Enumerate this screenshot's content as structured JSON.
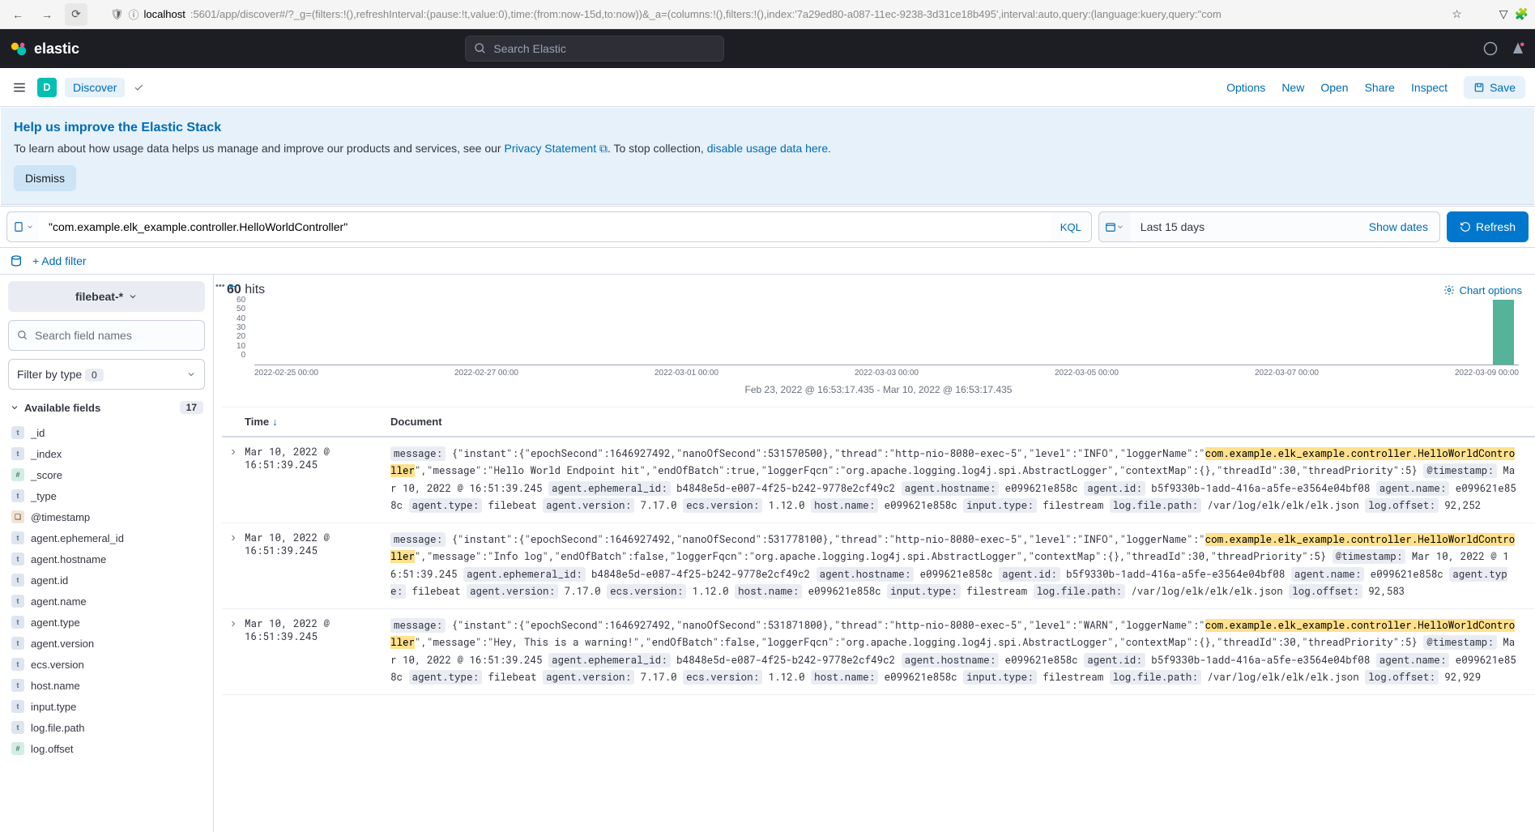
{
  "browser": {
    "url_host": "localhost",
    "url_rest": ":5601/app/discover#/?_g=(filters:!(),refreshInterval:(pause:!t,value:0),time:(from:now-15d,to:now))&_a=(columns:!(),filters:!(),index:'7a29ed80-a087-11ec-9238-3d31ce18b495',interval:auto,query:(language:kuery,query:\"com"
  },
  "elastic": {
    "brand": "elastic",
    "search_placeholder": "Search Elastic"
  },
  "nav": {
    "space_letter": "D",
    "app": "Discover",
    "links": [
      "Options",
      "New",
      "Open",
      "Share",
      "Inspect"
    ],
    "save": "Save"
  },
  "banner": {
    "title": "Help us improve the Elastic Stack",
    "text_pre": "To learn about how usage data helps us manage and improve our products and services, see our ",
    "privacy": "Privacy Statement",
    "text_mid": ". To stop collection, ",
    "disable": "disable usage data here.",
    "dismiss": "Dismiss"
  },
  "query": {
    "value": "\"com.example.elk_example.controller.HelloWorldController\"",
    "kql": "KQL",
    "range": "Last 15 days",
    "show_dates": "Show dates",
    "refresh": "Refresh"
  },
  "filters": {
    "add": "+ Add filter"
  },
  "sidebar": {
    "index": "filebeat-*",
    "search_fields_ph": "Search field names",
    "filter_type_label": "Filter by type",
    "filter_type_count": "0",
    "available_label": "Available fields",
    "available_count": "17",
    "fields": [
      {
        "type": "t",
        "name": "_id"
      },
      {
        "type": "t",
        "name": "_index"
      },
      {
        "type": "n",
        "name": "_score"
      },
      {
        "type": "t",
        "name": "_type"
      },
      {
        "type": "d",
        "name": "@timestamp"
      },
      {
        "type": "t",
        "name": "agent.ephemeral_id"
      },
      {
        "type": "t",
        "name": "agent.hostname"
      },
      {
        "type": "t",
        "name": "agent.id"
      },
      {
        "type": "t",
        "name": "agent.name"
      },
      {
        "type": "t",
        "name": "agent.type"
      },
      {
        "type": "t",
        "name": "agent.version"
      },
      {
        "type": "t",
        "name": "ecs.version"
      },
      {
        "type": "t",
        "name": "host.name"
      },
      {
        "type": "t",
        "name": "input.type"
      },
      {
        "type": "t",
        "name": "log.file.path"
      },
      {
        "type": "n",
        "name": "log.offset"
      }
    ]
  },
  "hits": {
    "count": "60",
    "label": " hits",
    "chart_options": "Chart options"
  },
  "chart_data": {
    "type": "bar",
    "ylim": [
      0,
      60
    ],
    "y_ticks": [
      "60",
      "50",
      "40",
      "30",
      "20",
      "10",
      "0"
    ],
    "x_ticks": [
      "2022-02-25 00:00",
      "2022-02-27 00:00",
      "2022-03-01 00:00",
      "2022-03-03 00:00",
      "2022-03-05 00:00",
      "2022-03-07 00:00",
      "2022-03-09 00:00"
    ],
    "series": [
      {
        "name": "count",
        "x": "2022-03-10",
        "value": 60
      }
    ],
    "caption": "Feb 23, 2022 @ 16:53:17.435 - Mar 10, 2022 @ 16:53:17.435"
  },
  "table": {
    "col_time": "Time",
    "col_doc": "Document",
    "rows": [
      {
        "time": "Mar 10, 2022 @ 16:51:39.245",
        "msg_pre": "{\"instant\":{\"epochSecond\":1646927492,\"nanoOfSecond\":531570500},\"thread\":\"http-nio-8080-exec-5\",\"level\":\"INFO\",\"loggerName\":\"",
        "msg_hl": "com.example.elk_example.controller.HelloWorldController",
        "msg_post": "\",\"message\":\"Hello World Endpoint hit\",\"endOfBatch\":true,\"loggerFqcn\":\"org.apache.logging.log4j.spi.AbstractLogger\",\"contextMap\":{},\"threadId\":30,\"threadPriority\":5}",
        "ts": "Mar 10, 2022 @ 16:51:39.245",
        "eph": "b4848e5d-e007-4f25-b242-9778e2cf49c2",
        "hostname": "e099621e858c",
        "agentid": "b5f9330b-1add-416a-a5fe-e3564e04bf08",
        "agentname": "e099621e858c",
        "agenttype": "filebeat",
        "agentver": "7.17.0",
        "ecs": "1.12.0",
        "hostn": "e099621e858c",
        "inputtype": "filestream",
        "logpath": "/var/log/elk/elk/elk.json",
        "offset": "92,252"
      },
      {
        "time": "Mar 10, 2022 @ 16:51:39.245",
        "msg_pre": "{\"instant\":{\"epochSecond\":1646927492,\"nanoOfSecond\":531778100},\"thread\":\"http-nio-8080-exec-5\",\"level\":\"INFO\",\"loggerName\":\"",
        "msg_hl": "com.example.elk_example.controller.HelloWorldController",
        "msg_post": "\",\"message\":\"Info log\",\"endOfBatch\":false,\"loggerFqcn\":\"org.apache.logging.log4j.spi.AbstractLogger\",\"contextMap\":{},\"threadId\":30,\"threadPriority\":5}",
        "ts": "Mar 10, 2022 @ 16:51:39.245",
        "eph": "b4848e5d-e087-4f25-b242-9778e2cf49c2",
        "hostname": "e099621e858c",
        "agentid": "b5f9330b-1add-416a-a5fe-e3564e04bf08",
        "agentname": "e099621e858c",
        "agenttype": "filebeat",
        "agentver": "7.17.0",
        "ecs": "1.12.0",
        "hostn": "e099621e858c",
        "inputtype": "filestream",
        "logpath": "/var/log/elk/elk/elk.json",
        "offset": "92,583"
      },
      {
        "time": "Mar 10, 2022 @ 16:51:39.245",
        "msg_pre": "{\"instant\":{\"epochSecond\":1646927492,\"nanoOfSecond\":531871800},\"thread\":\"http-nio-8080-exec-5\",\"level\":\"WARN\",\"loggerName\":\"",
        "msg_hl": "com.example.elk_example.controller.HelloWorldController",
        "msg_post": "\",\"message\":\"Hey, This is a warning!\",\"endOfBatch\":false,\"loggerFqcn\":\"org.apache.logging.log4j.spi.AbstractLogger\",\"contextMap\":{},\"threadId\":30,\"threadPriority\":5}",
        "ts": "Mar 10, 2022 @ 16:51:39.245",
        "eph": "b4848e5d-e087-4f25-b242-9778e2cf49c2",
        "hostname": "e099621e858c",
        "agentid": "b5f9330b-1add-416a-a5fe-e3564e04bf08",
        "agentname": "e099621e858c",
        "agenttype": "filebeat",
        "agentver": "7.17.0",
        "ecs": "1.12.0",
        "hostn": "e099621e858c",
        "inputtype": "filestream",
        "logpath": "/var/log/elk/elk/elk.json",
        "offset": "92,929"
      }
    ],
    "keys": {
      "message": "message:",
      "timestamp": "@timestamp:",
      "eph": "agent.ephemeral_id:",
      "hostname": "agent.hostname:",
      "agentid": "agent.id:",
      "agentname": "agent.name:",
      "agenttype": "agent.type:",
      "agentver": "agent.version:",
      "ecs": "ecs.version:",
      "hostn": "host.name:",
      "inputtype": "input.type:",
      "logpath": "log.file.path:",
      "offset": "log.offset:"
    }
  }
}
